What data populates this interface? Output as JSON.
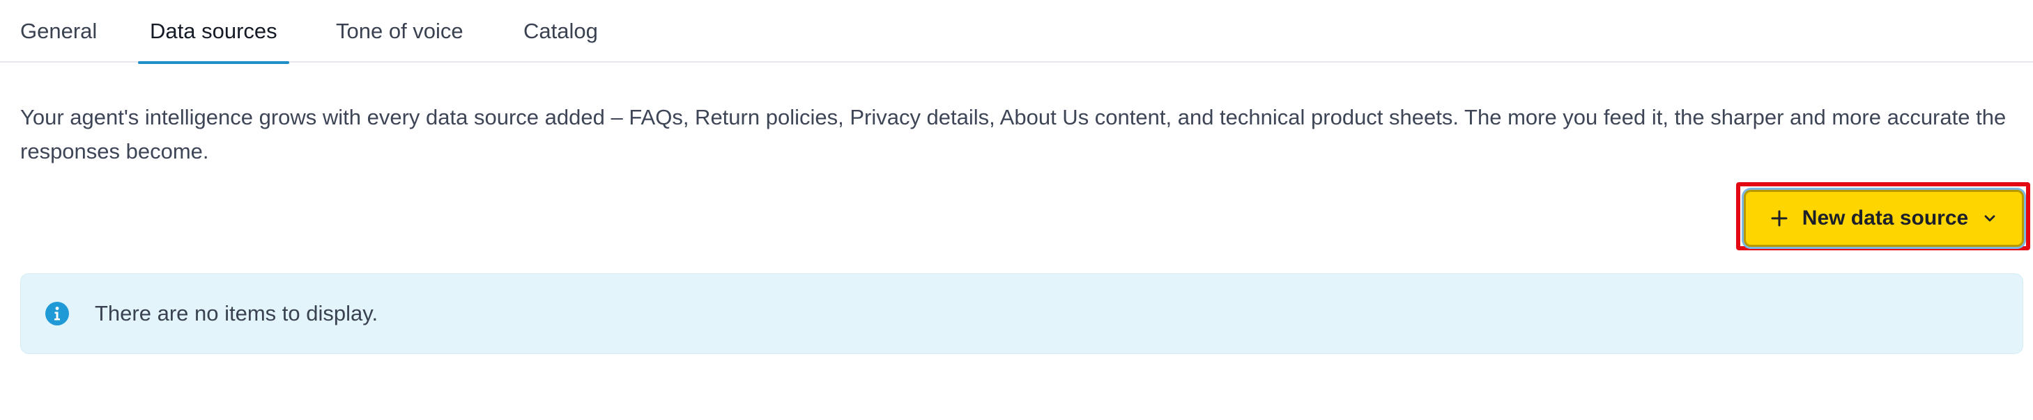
{
  "tabs": [
    {
      "label": "General",
      "active": false
    },
    {
      "label": "Data sources",
      "active": true
    },
    {
      "label": "Tone of voice",
      "active": false
    },
    {
      "label": "Catalog",
      "active": false
    }
  ],
  "description": "Your agent's intelligence grows with every data source added – FAQs, Return policies, Privacy details, About Us content, and technical product sheets. The more you feed it, the sharper and more accurate the responses become.",
  "new_source_button": {
    "label": "New data source",
    "leading_icon": "plus-icon",
    "trailing_icon": "chevron-down-icon",
    "background_color": "#ffd500"
  },
  "info_banner": {
    "icon": "info-icon",
    "text": "There are no items to display.",
    "background_color": "#e3f4fb",
    "icon_color": "#1f9ad6"
  },
  "colors": {
    "active_tab_underline": "#1f8fc7",
    "highlight_box": "#e30613"
  }
}
